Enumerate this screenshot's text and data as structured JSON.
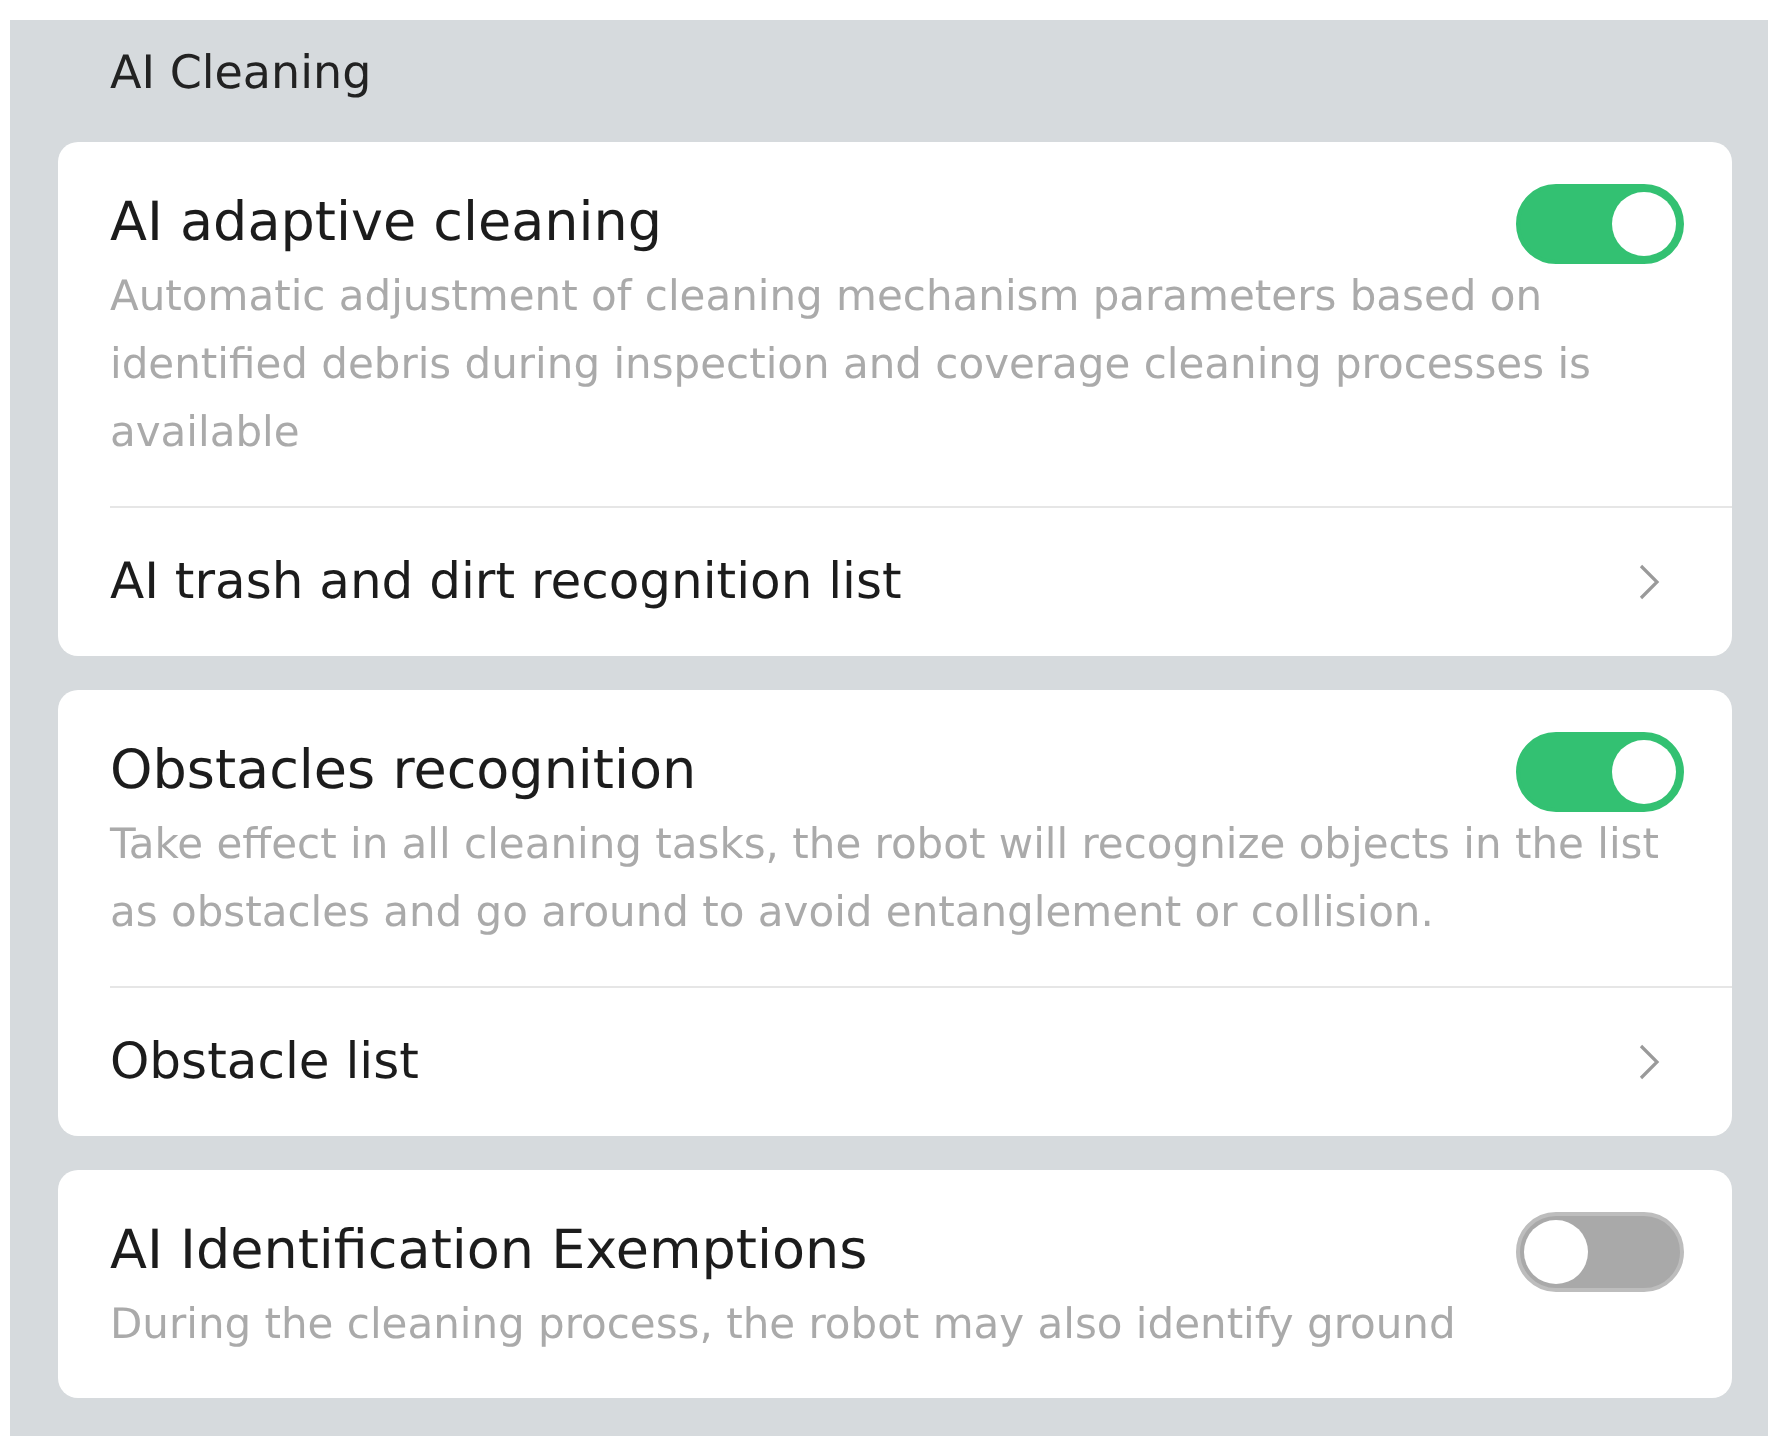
{
  "section_title": "AI Cleaning",
  "cards": [
    {
      "title": "AI adaptive cleaning",
      "on": true,
      "description": "Automatic adjustment of cleaning mechanism parameters based on identified debris during inspection and coverage cleaning processes is available",
      "link": "AI trash and dirt recognition list"
    },
    {
      "title": "Obstacles recognition",
      "on": true,
      "description": "Take effect in all cleaning tasks, the robot will recognize objects in the list as obstacles and go around to avoid entanglement or collision.",
      "link": "Obstacle list"
    },
    {
      "title": "AI Identification Exemptions",
      "on": false,
      "description": "During the cleaning process, the robot may also identify ground"
    }
  ]
}
